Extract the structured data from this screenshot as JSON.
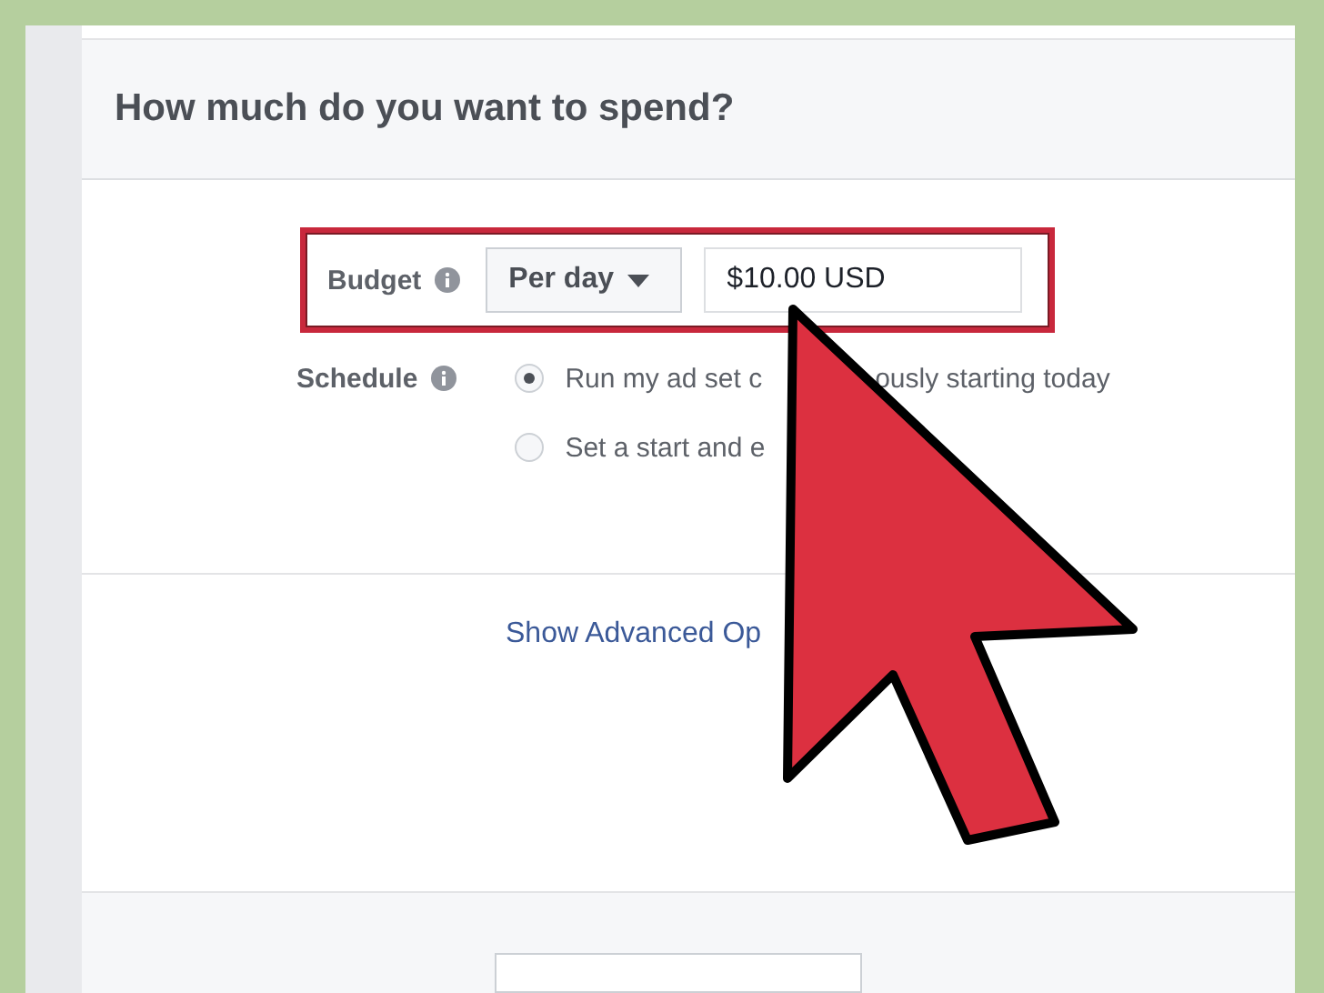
{
  "section": {
    "title": "How much do you want to spend?"
  },
  "budget": {
    "label": "Budget",
    "period": "Per day",
    "amount": "$10.00 USD",
    "highlighted": true
  },
  "schedule": {
    "label": "Schedule",
    "options": [
      {
        "selected": true,
        "label_parts": [
          "Run my ad set c",
          "ously starting today"
        ]
      },
      {
        "selected": false,
        "label_parts": [
          "Set a start and e"
        ]
      }
    ]
  },
  "advanced_link": "Show Advanced Op"
}
